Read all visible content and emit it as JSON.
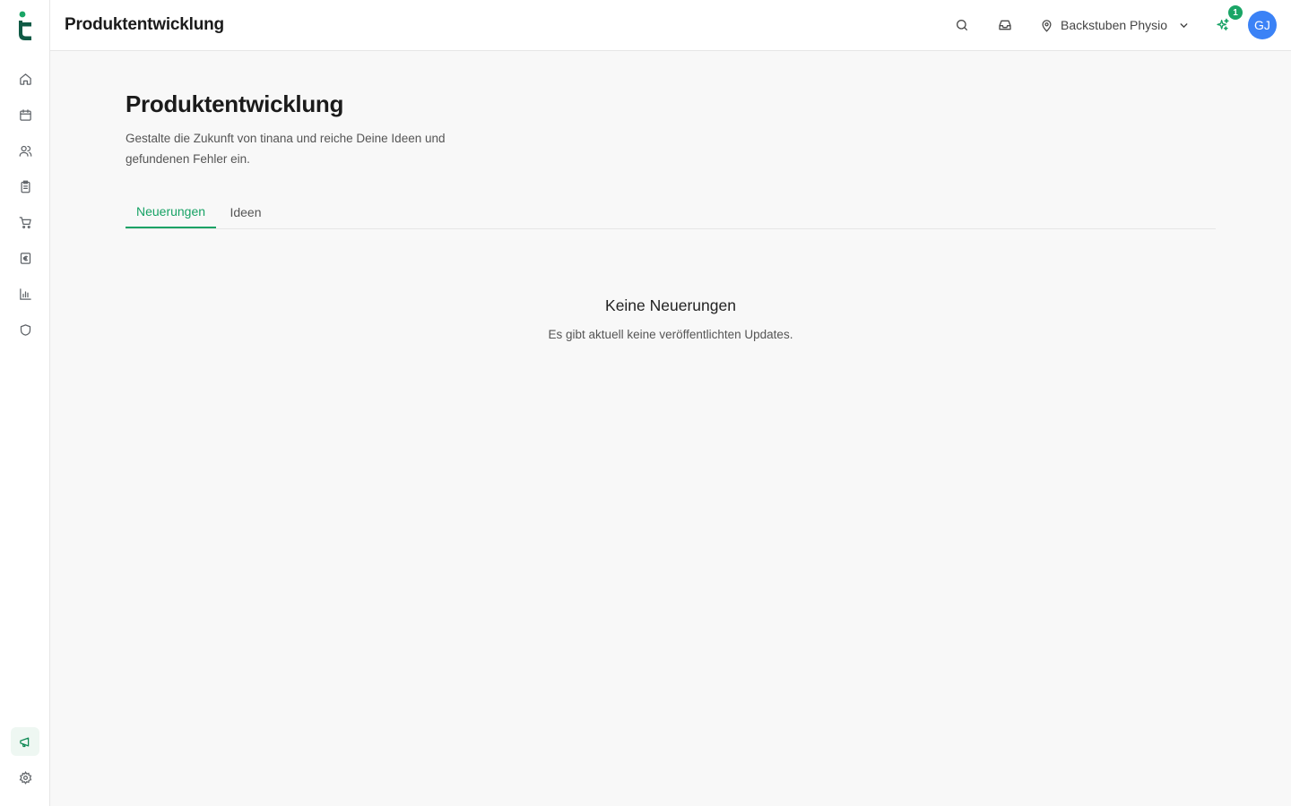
{
  "app": {
    "brand_color": "#0f5a45",
    "accent": "#17a265"
  },
  "sidebar": {
    "items": [
      {
        "icon": "home-icon"
      },
      {
        "icon": "calendar-icon"
      },
      {
        "icon": "users-icon"
      },
      {
        "icon": "clipboard-icon"
      },
      {
        "icon": "cart-icon"
      },
      {
        "icon": "euro-receipt-icon"
      },
      {
        "icon": "bar-chart-icon"
      },
      {
        "icon": "shield-icon"
      }
    ],
    "bottom": [
      {
        "icon": "megaphone-icon",
        "active": true
      },
      {
        "icon": "gear-icon"
      }
    ]
  },
  "header": {
    "title": "Produktentwicklung",
    "location": "Backstuben Physio",
    "sparkle_badge": "1",
    "avatar_initials": "GJ"
  },
  "main": {
    "title": "Produktentwicklung",
    "description": "Gestalte die Zukunft von tinana und reiche Deine Ideen und gefundenen Fehler ein.",
    "tabs": [
      {
        "label": "Neuerungen",
        "active": true
      },
      {
        "label": "Ideen",
        "active": false
      }
    ],
    "empty_state": {
      "title": "Keine Neuerungen",
      "description": "Es gibt aktuell keine veröffentlichten Updates."
    }
  }
}
